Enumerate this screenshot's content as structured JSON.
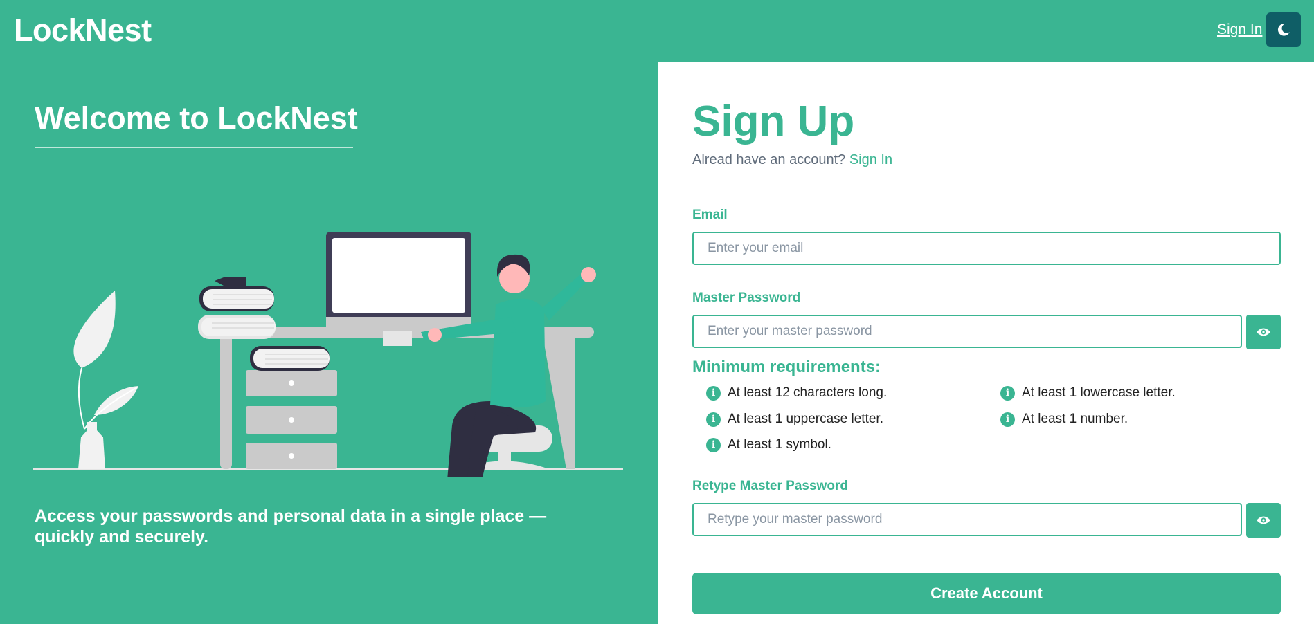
{
  "header": {
    "brand": "LockNest",
    "signin_label": "Sign In",
    "theme_icon": "moon-icon"
  },
  "hero": {
    "title": "Welcome to LockNest",
    "tagline": "Access your passwords and personal data in a single place — quickly and securely."
  },
  "signup": {
    "title": "Sign Up",
    "have_account_text": "Alread have an account?",
    "signin_link": "Sign In",
    "email_label": "Email",
    "email_placeholder": "Enter your email",
    "password_label": "Master Password",
    "password_placeholder": "Enter your master password",
    "requirements_title": "Minimum requirements:",
    "requirements": [
      "At least 12 characters long.",
      "At least 1 lowercase letter.",
      "At least 1 uppercase letter.",
      "At least 1 number.",
      "At least 1 symbol."
    ],
    "retype_label": "Retype Master Password",
    "retype_placeholder": "Retype your master password",
    "create_label": "Create Account"
  },
  "colors": {
    "accent": "#3ab592",
    "theme_button": "#0f5e66"
  }
}
